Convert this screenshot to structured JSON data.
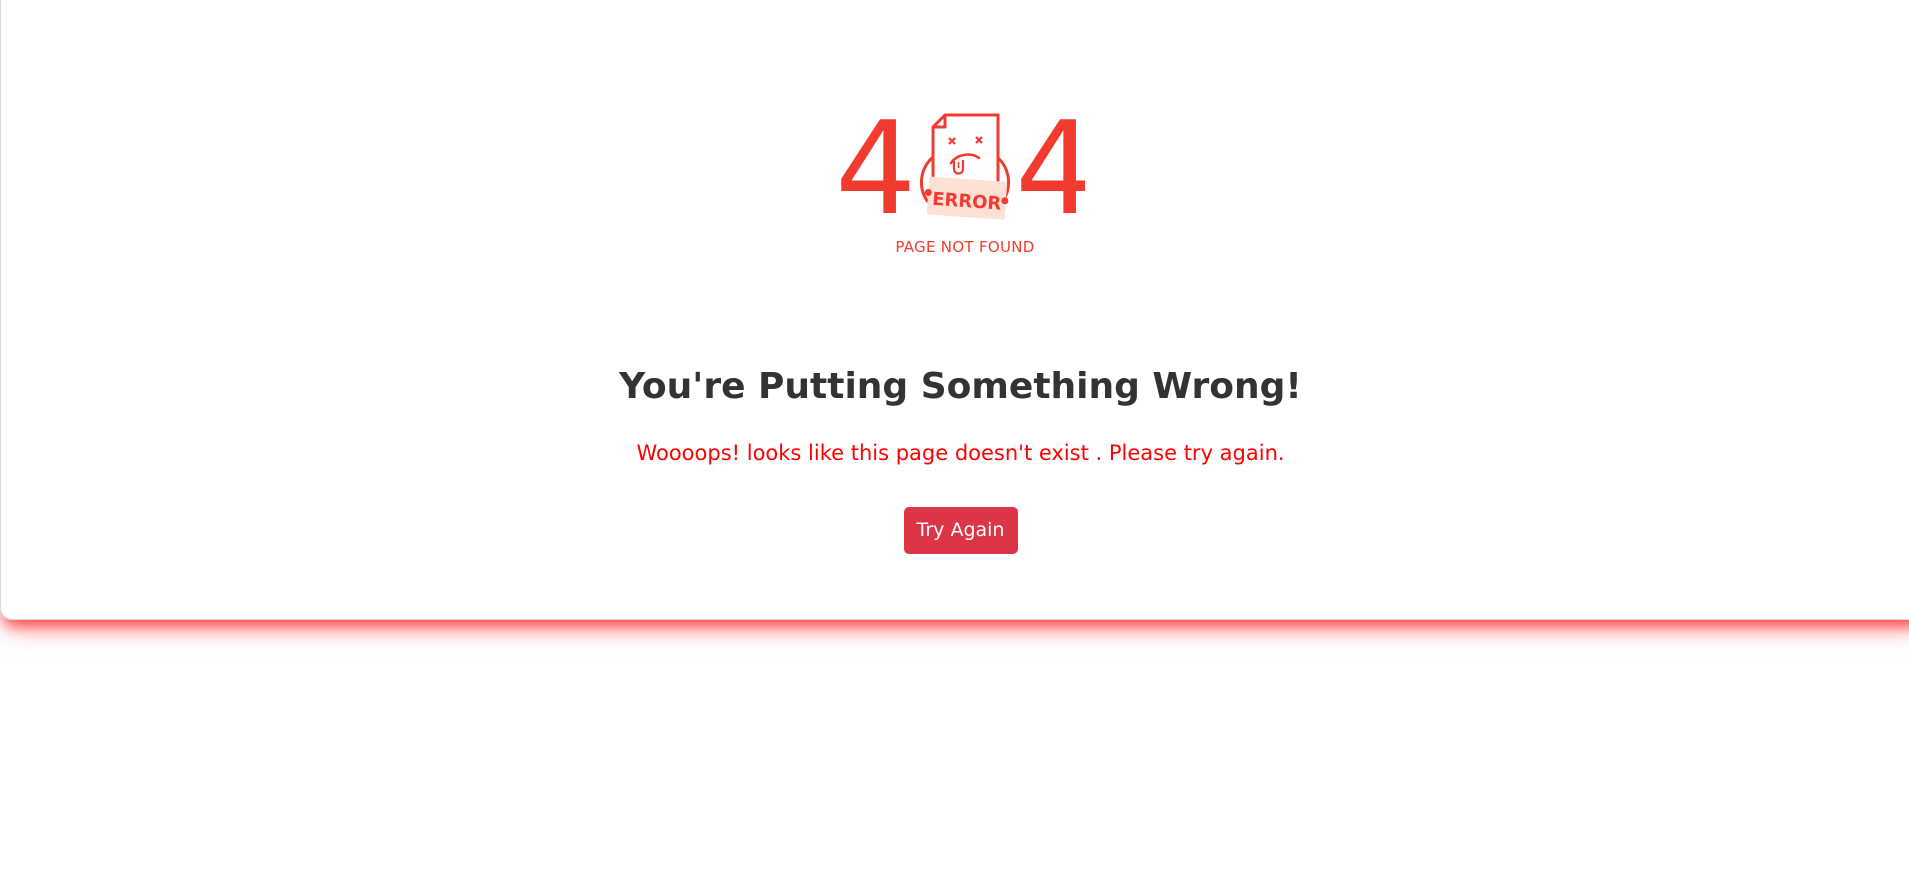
{
  "illustration": {
    "left_digit": "4",
    "right_digit": "4",
    "badge_text": "ERROR",
    "caption": "PAGE NOT FOUND",
    "icon": "sad-document-icon"
  },
  "main": {
    "headline": "You're Putting Something Wrong!",
    "message": "Woooops! looks like this page doesn't exist . Please try again.",
    "button_label": "Try Again"
  },
  "colors": {
    "accent": "#f13b2f",
    "message": "#ff0000",
    "button": "#dc3545",
    "headline": "#333333",
    "badge_bg": "#fde0d6"
  }
}
